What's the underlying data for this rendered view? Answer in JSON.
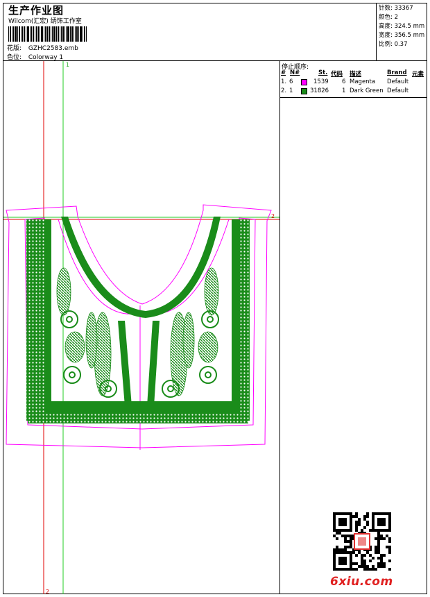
{
  "header": {
    "title": "生产作业图",
    "company": "Wilcom(汇宏) 绣饰工作室",
    "design_label": "花版:",
    "design_value": "GZHC2583.emb",
    "colorway_label": "色位:",
    "colorway_value": "Colorway 1"
  },
  "stats": {
    "stitches": "针数: 33367",
    "colors": "颜色: 2",
    "height": "高度: 324.5 mm",
    "width": "宽度: 356.5 mm",
    "scale": "比例: 0.37"
  },
  "stop_sequence": {
    "title": "停止顺序:",
    "headers": [
      "#",
      "N#",
      "St.",
      "代码",
      "描述",
      "Brand",
      "元素"
    ],
    "rows": [
      {
        "idx": "1.",
        "needle": "6",
        "color": "#ff00ff",
        "stitches": "1539",
        "code": "6",
        "desc": "Magenta",
        "brand": "Default"
      },
      {
        "idx": "2.",
        "needle": "1",
        "color": "#1a8c1a",
        "stitches": "31826",
        "code": "1",
        "desc": "Dark Green",
        "brand": "Default"
      }
    ]
  },
  "guides": {
    "v1": "1",
    "v2": "2",
    "h2": "2"
  },
  "watermark": "6xiu.com",
  "colors": {
    "magenta": "#ff00ff",
    "green": "#1a8c1a",
    "guide_red": "#e00000",
    "guide_green": "#22cc22"
  }
}
